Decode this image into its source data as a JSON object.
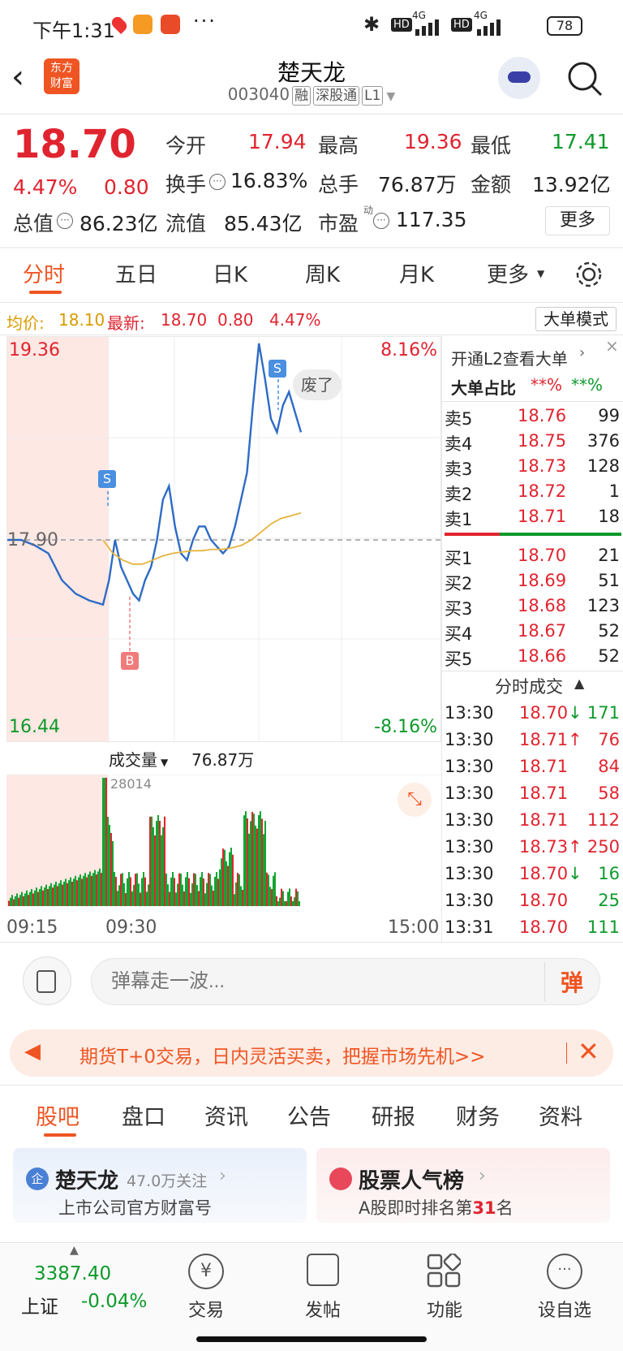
{
  "status_bar": {
    "time": "下午1:31",
    "battery": "78",
    "net1": "4G",
    "net2": "4G",
    "hd": "HD"
  },
  "header": {
    "title": "楚天龙",
    "code": "003040",
    "tags": [
      "融",
      "深股通",
      "L1"
    ],
    "logo_line1": "东方",
    "logo_line2": "财富"
  },
  "quote": {
    "price": "18.70",
    "pct": "4.47%",
    "chg": "0.80",
    "rows": [
      [
        {
          "label": "今开",
          "value": "17.94",
          "color": "red"
        },
        {
          "label": "最高",
          "value": "19.36",
          "color": "red"
        },
        {
          "label": "最低",
          "value": "17.41",
          "color": "green"
        }
      ],
      [
        {
          "label": "换手",
          "value": "16.83%",
          "color": "dark"
        },
        {
          "label": "总手",
          "value": "76.87万",
          "color": "dark"
        },
        {
          "label": "金额",
          "value": "13.92亿",
          "color": "dark"
        }
      ],
      [
        {
          "label": "总值",
          "value": "86.23亿",
          "color": "dark"
        },
        {
          "label": "流值",
          "value": "85.43亿",
          "color": "dark"
        },
        {
          "label": "市盈",
          "value": "117.35",
          "color": "dark"
        }
      ]
    ],
    "more": "更多",
    "pe_sup": "动"
  },
  "ktabs": [
    "分时",
    "五日",
    "日K",
    "周K",
    "月K",
    "更多"
  ],
  "info_line": {
    "avg_label": "均价:",
    "avg": "18.10",
    "latest_label": "最新:",
    "latest": "18.70",
    "chg": "0.80",
    "pct": "4.47%",
    "mode": "大单模式"
  },
  "chart": {
    "ymax": "19.36",
    "ymin": "16.44",
    "pmax": "8.16%",
    "pmin": "-8.16%",
    "pre_close": "17.90",
    "marker_s": "S",
    "marker_b": "B",
    "bubble": "废了",
    "volume_label": "成交量",
    "volume_total": "76.87万",
    "volume_peak": "28014",
    "times": [
      "09:15",
      "09:30",
      "15:00"
    ]
  },
  "chart_data": {
    "type": "line",
    "series": [
      {
        "values": [
          17.9,
          17.9,
          17.86,
          17.8,
          17.6,
          17.5,
          17.45,
          17.42,
          17.6,
          17.9,
          17.7,
          17.6,
          17.5,
          17.45,
          17.6,
          17.7,
          17.9,
          18.2,
          18.3,
          18.0,
          17.8,
          17.75,
          17.9,
          18.0,
          18.0,
          17.9,
          17.85,
          17.8,
          17.85,
          18.0,
          18.2,
          18.4,
          18.9,
          19.36,
          19.1,
          18.8,
          18.7,
          18.9,
          19.0,
          18.85,
          18.7
        ]
      },
      {
        "values": [
          17.9,
          17.8,
          17.75,
          17.72,
          17.72,
          17.75,
          17.78,
          17.8,
          17.81,
          17.82,
          17.82,
          17.83,
          17.83,
          17.84,
          17.86,
          17.9,
          17.96,
          18.02,
          18.06,
          18.08,
          18.1
        ]
      }
    ],
    "ylim": [
      16.44,
      19.36
    ],
    "pre_close": 17.9
  },
  "order_book": {
    "link": "开通L2查看大单",
    "ratio_label": "大单占比",
    "ratio_a": "**%",
    "ratio_b": "**%",
    "asks": [
      {
        "label": "卖5",
        "price": "18.76",
        "vol": "99"
      },
      {
        "label": "卖4",
        "price": "18.75",
        "vol": "376"
      },
      {
        "label": "卖3",
        "price": "18.73",
        "vol": "128"
      },
      {
        "label": "卖2",
        "price": "18.72",
        "vol": "1"
      },
      {
        "label": "卖1",
        "price": "18.71",
        "vol": "18"
      }
    ],
    "bids": [
      {
        "label": "买1",
        "price": "18.70",
        "vol": "21"
      },
      {
        "label": "买2",
        "price": "18.69",
        "vol": "51"
      },
      {
        "label": "买3",
        "price": "18.68",
        "vol": "123"
      },
      {
        "label": "买4",
        "price": "18.67",
        "vol": "52"
      },
      {
        "label": "买5",
        "price": "18.66",
        "vol": "52"
      }
    ]
  },
  "ticks": {
    "title": "分时成交",
    "rows": [
      {
        "time": "13:30",
        "price": "18.70",
        "arrow": "↓",
        "vol": "171",
        "dir": "down"
      },
      {
        "time": "13:30",
        "price": "18.71",
        "arrow": "↑",
        "vol": "76",
        "dir": "up"
      },
      {
        "time": "13:30",
        "price": "18.71",
        "arrow": "",
        "vol": "84",
        "dir": "up"
      },
      {
        "time": "13:30",
        "price": "18.71",
        "arrow": "",
        "vol": "58",
        "dir": "up"
      },
      {
        "time": "13:30",
        "price": "18.71",
        "arrow": "",
        "vol": "112",
        "dir": "up"
      },
      {
        "time": "13:30",
        "price": "18.73",
        "arrow": "↑",
        "vol": "250",
        "dir": "up"
      },
      {
        "time": "13:30",
        "price": "18.70",
        "arrow": "↓",
        "vol": "16",
        "dir": "down"
      },
      {
        "time": "13:30",
        "price": "18.70",
        "arrow": "",
        "vol": "25",
        "dir": "down"
      },
      {
        "time": "13:31",
        "price": "18.70",
        "arrow": "",
        "vol": "111",
        "dir": "down"
      }
    ]
  },
  "comment": {
    "placeholder": "弹幕走一波...",
    "danmu_btn": "弹"
  },
  "banner": {
    "text": "期货T+0交易，日内灵活买卖，把握市场先机>>"
  },
  "bottom_tabs": [
    "股吧",
    "盘口",
    "资讯",
    "公告",
    "研报",
    "财务",
    "资料"
  ],
  "cards": {
    "left": {
      "badge": "企",
      "title": "楚天龙",
      "follow": "47.0万关注",
      "sub": "上市公司官方财富号"
    },
    "right": {
      "title": "股票人气榜",
      "sub_pre": "A股即时排名第",
      "rank": "31",
      "sub_post": "名"
    }
  },
  "bottom_nav": {
    "index_value": "3387.40",
    "index_name": "上证",
    "index_chg": "-0.04%",
    "items": [
      "交易",
      "发帖",
      "功能",
      "设自选"
    ]
  }
}
